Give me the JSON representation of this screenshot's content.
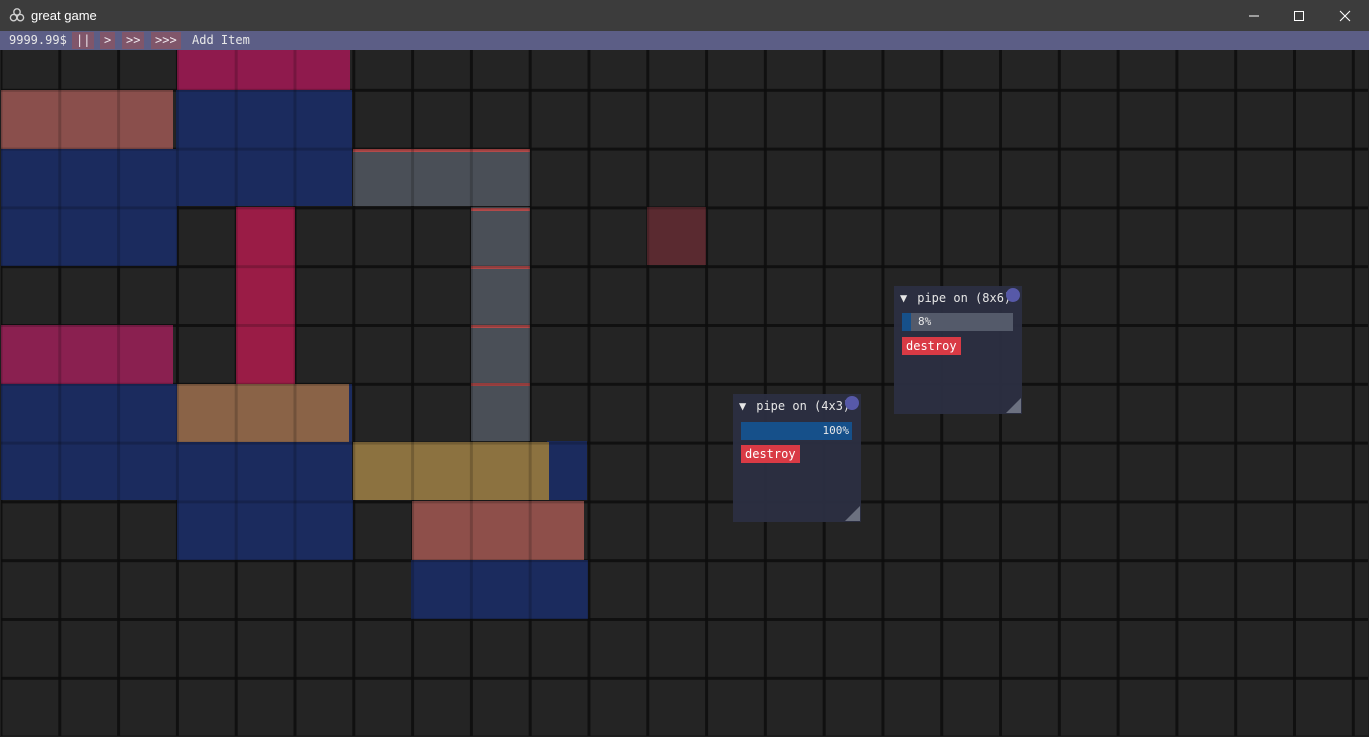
{
  "window": {
    "title": "great game",
    "icon": "biohazard-icon"
  },
  "menubar": {
    "money": "9999.99$",
    "speed_buttons": [
      "||",
      ">",
      ">>",
      ">>>"
    ],
    "add_item": "Add Item"
  },
  "colors": {
    "navy": "#1b2b5e",
    "crimson": "#8f1a4d",
    "salmon": "#8a4f4c",
    "tan": "#8a6347",
    "gold": "#8c7240",
    "pipe": "#4a4f57",
    "pipe_rim": "#b24a4a",
    "dark_red": "#5a2a30",
    "panel_bg": "#2c2f42",
    "progress_fill": "#16508a",
    "destroy": "#d93a45"
  },
  "panels": [
    {
      "title": "pipe on (8x6)",
      "collapse_icon": "▼",
      "progress_text": "8%",
      "progress": 0.08,
      "destroy_label": "destroy"
    },
    {
      "title": "pipe on (4x3)",
      "collapse_icon": "▼",
      "progress_text": "100%",
      "progress": 1.0,
      "destroy_label": "destroy"
    }
  ]
}
